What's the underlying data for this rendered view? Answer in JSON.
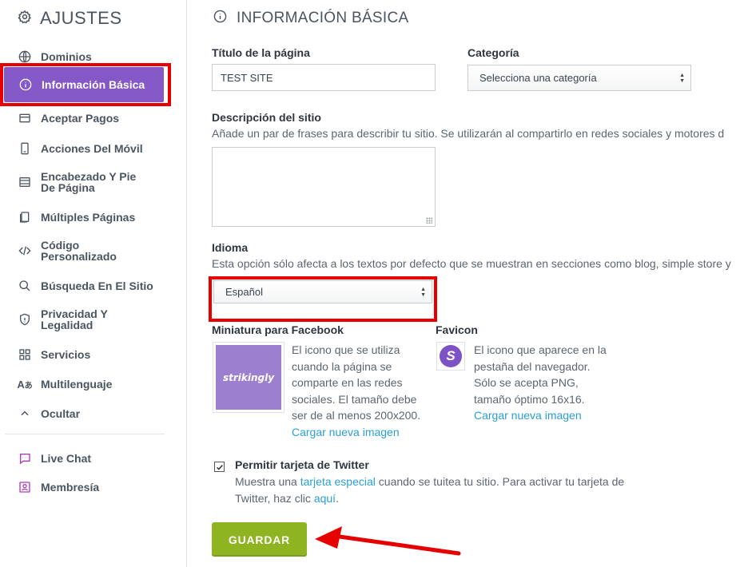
{
  "sidebar": {
    "title": "AJUSTES",
    "items": [
      {
        "label": "Dominios",
        "icon": "globe-icon"
      },
      {
        "label": "Información Básica",
        "icon": "info-icon"
      },
      {
        "label": "Aceptar Pagos",
        "icon": "card-icon"
      },
      {
        "label": "Acciones Del Móvil",
        "icon": "mobile-icon"
      },
      {
        "label": "Encabezado Y Pie De Página",
        "icon": "layout-icon"
      },
      {
        "label": "Múltiples Páginas",
        "icon": "pages-icon"
      },
      {
        "label": "Código Personalizado",
        "icon": "code-icon"
      },
      {
        "label": "Búsqueda En El Sitio",
        "icon": "search-icon"
      },
      {
        "label": "Privacidad Y Legalidad",
        "icon": "shield-icon"
      },
      {
        "label": "Servicios",
        "icon": "grid-icon"
      },
      {
        "label": "Multilenguaje",
        "icon": "translate-icon"
      },
      {
        "label": "Ocultar",
        "icon": "chevron-up-icon"
      }
    ],
    "extra_items": [
      {
        "label": "Live Chat",
        "icon": "chat-icon"
      },
      {
        "label": "Membresía",
        "icon": "member-icon"
      }
    ]
  },
  "main": {
    "title": "INFORMACIÓN BÁSICA",
    "page_title_label": "Título de la página",
    "page_title_value": "TEST SITE",
    "category_label": "Categoría",
    "category_value": "Selecciona una categoría",
    "description_label": "Descripción del sitio",
    "description_help": "Añade un par de frases para describir tu sitio. Se utilizarán al compartirlo en redes sociales y motores d",
    "description_value": "",
    "language_label": "Idioma",
    "language_help": "Esta opción sólo afecta a los textos por defecto que se muestran en secciones como blog, simple store y",
    "language_value": "Español",
    "facebook_label": "Miniatura para Facebook",
    "facebook_thumb_text": "strikingly",
    "facebook_desc_lines": [
      "El icono que se utiliza",
      "cuando la página se",
      "comparte en las redes",
      "sociales. El tamaño debe",
      "ser de al menos 200x200."
    ],
    "facebook_upload": "Cargar nueva imagen",
    "favicon_label": "Favicon",
    "favicon_letter": "S",
    "favicon_desc_lines": [
      "El icono que aparece en la",
      "pestaña del navegador.",
      "Sólo se acepta PNG,",
      "tamaño óptimo 16x16."
    ],
    "favicon_upload": "Cargar nueva imagen",
    "twitter_label": "Permitir tarjeta de Twitter",
    "twitter_checked": true,
    "twitter_text_1": "Muestra una ",
    "twitter_link_1": "tarjeta especial",
    "twitter_text_2": " cuando se tuitea tu sitio. Para activar tu tarjeta de",
    "twitter_text_3": "Twitter, haz clic ",
    "twitter_link_2": "aquí",
    "twitter_text_4": ".",
    "save_label": "GUARDAR"
  },
  "colors": {
    "accent": "#8558c8",
    "save": "#8fb422",
    "link": "#2a9fd6",
    "highlight": "#e60000"
  }
}
